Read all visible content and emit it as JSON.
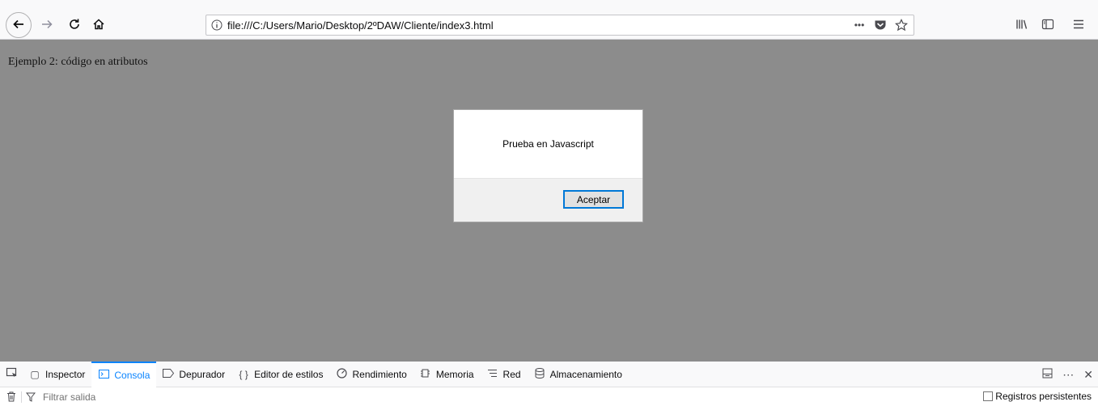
{
  "browser": {
    "url": "file:///C:/Users/Mario/Desktop/2ºDAW/Cliente/index3.html",
    "page_actions_glyph": "•••"
  },
  "page": {
    "text": "Ejemplo 2: código en atributos"
  },
  "dialog": {
    "message": "Prueba en Javascript",
    "ok_label": "Aceptar"
  },
  "devtools": {
    "tabs": [
      {
        "label": "Inspector",
        "icon": "inspector-icon"
      },
      {
        "label": "Consola",
        "icon": "console-icon",
        "active": true
      },
      {
        "label": "Depurador",
        "icon": "debugger-icon"
      },
      {
        "label": "Editor de estilos",
        "icon": "style-editor-icon"
      },
      {
        "label": "Rendimiento",
        "icon": "performance-icon"
      },
      {
        "label": "Memoria",
        "icon": "memory-icon"
      },
      {
        "label": "Red",
        "icon": "network-icon"
      },
      {
        "label": "Almacenamiento",
        "icon": "storage-icon"
      }
    ],
    "filter_placeholder": "Filtrar salida",
    "persist_label": "Registros persistentes"
  },
  "colors": {
    "accent": "#0a84ff",
    "content_bg": "#8c8c8c"
  }
}
